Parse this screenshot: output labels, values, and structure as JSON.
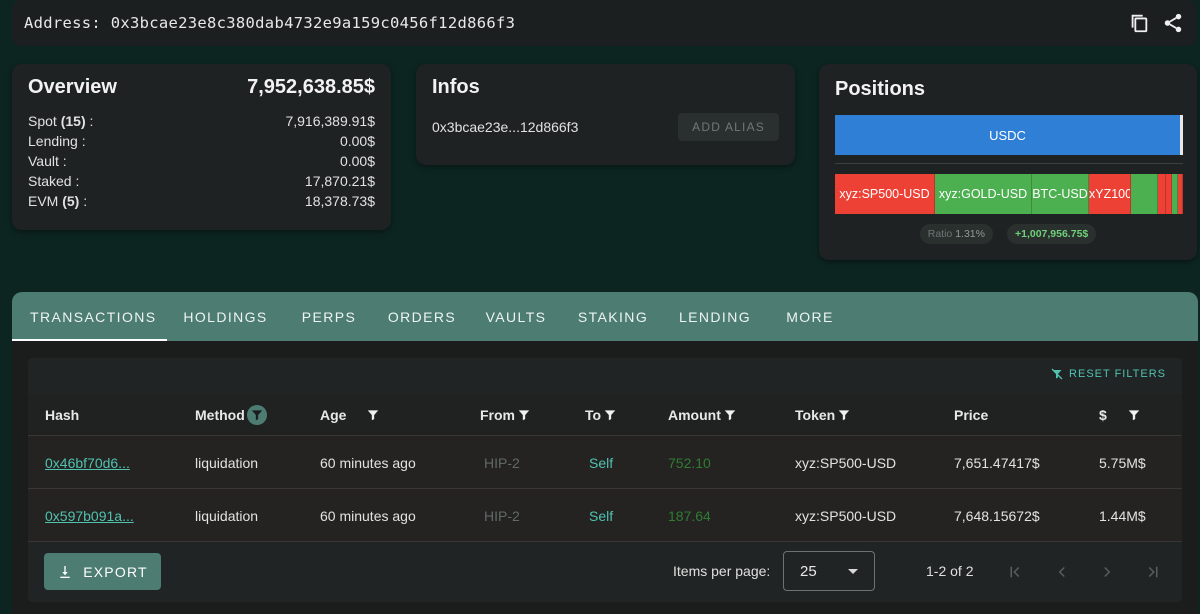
{
  "address_bar": {
    "label": "Address:",
    "address": "0x3bcae23e8c380dab4732e9a159c0456f12d866f3",
    "icons": [
      "copy-icon",
      "share-icon"
    ]
  },
  "overview": {
    "title": "Overview",
    "total": "7,952,638.85$",
    "rows": [
      {
        "label": "Spot",
        "count": "(15)",
        "suffix": " :",
        "value": "7,916,389.91$"
      },
      {
        "label": "Lending :",
        "count": "",
        "suffix": "",
        "value": "0.00$"
      },
      {
        "label": "Vault :",
        "count": "",
        "suffix": "",
        "value": "0.00$"
      },
      {
        "label": "Staked :",
        "count": "",
        "suffix": "",
        "value": "17,870.21$"
      },
      {
        "label": "EVM",
        "count": "(5)",
        "suffix": " :",
        "value": "18,378.73$"
      }
    ]
  },
  "infos": {
    "title": "Infos",
    "short_address": "0x3bcae23e...12d866f3",
    "add_alias_label": "ADD ALIAS"
  },
  "positions": {
    "title": "Positions",
    "usdc_label": "USDC",
    "segments": [
      {
        "label": "xyz:SP500-USD",
        "color": "#ee4136"
      },
      {
        "label": "xyz:GOLD-USD",
        "color": "#4caf50"
      },
      {
        "label": "BTC-USD",
        "color": "#4caf50"
      },
      {
        "label": "xYZ100",
        "color": "#ee4136"
      },
      {
        "label": "",
        "color": "#4caf50"
      },
      {
        "label": "",
        "color": "#ee4136"
      },
      {
        "label": "",
        "color": "#ee4136"
      },
      {
        "label": "",
        "color": "#4caf50"
      },
      {
        "label": "",
        "color": "#ee4136"
      }
    ],
    "ratio_label": "Ratio",
    "ratio_value": "1.31%",
    "pnl": "+1,007,956.75$"
  },
  "tabs": [
    "TRANSACTIONS",
    "HOLDINGS",
    "PERPS",
    "ORDERS",
    "VAULTS",
    "STAKING",
    "LENDING",
    "MORE"
  ],
  "active_tab": "TRANSACTIONS",
  "table": {
    "reset_filters_label": "RESET FILTERS",
    "columns": [
      "Hash",
      "Method",
      "Age",
      "From",
      "To",
      "Amount",
      "Token",
      "Price",
      "$"
    ],
    "rows": [
      {
        "hash": "0x46bf70d6...",
        "method": "liquidation",
        "age": "60 minutes ago",
        "from": "HIP-2",
        "to": "Self",
        "amount": "752.10",
        "token": "xyz:SP500-USD",
        "price": "7,651.47417$",
        "usd": "5.75M$"
      },
      {
        "hash": "0x597b091a...",
        "method": "liquidation",
        "age": "60 minutes ago",
        "from": "HIP-2",
        "to": "Self",
        "amount": "187.64",
        "token": "xyz:SP500-USD",
        "price": "7,648.15672$",
        "usd": "1.44M$"
      }
    ],
    "export_label": "EXPORT",
    "items_per_page_label": "Items per page:",
    "items_per_page": "25",
    "range": "1-2 of 2"
  },
  "colors": {
    "accent": "#4c7c72",
    "link": "#4fc3b0",
    "positive": "#4caf50",
    "negative": "#ee4136",
    "usdc": "#2f7fd6"
  }
}
